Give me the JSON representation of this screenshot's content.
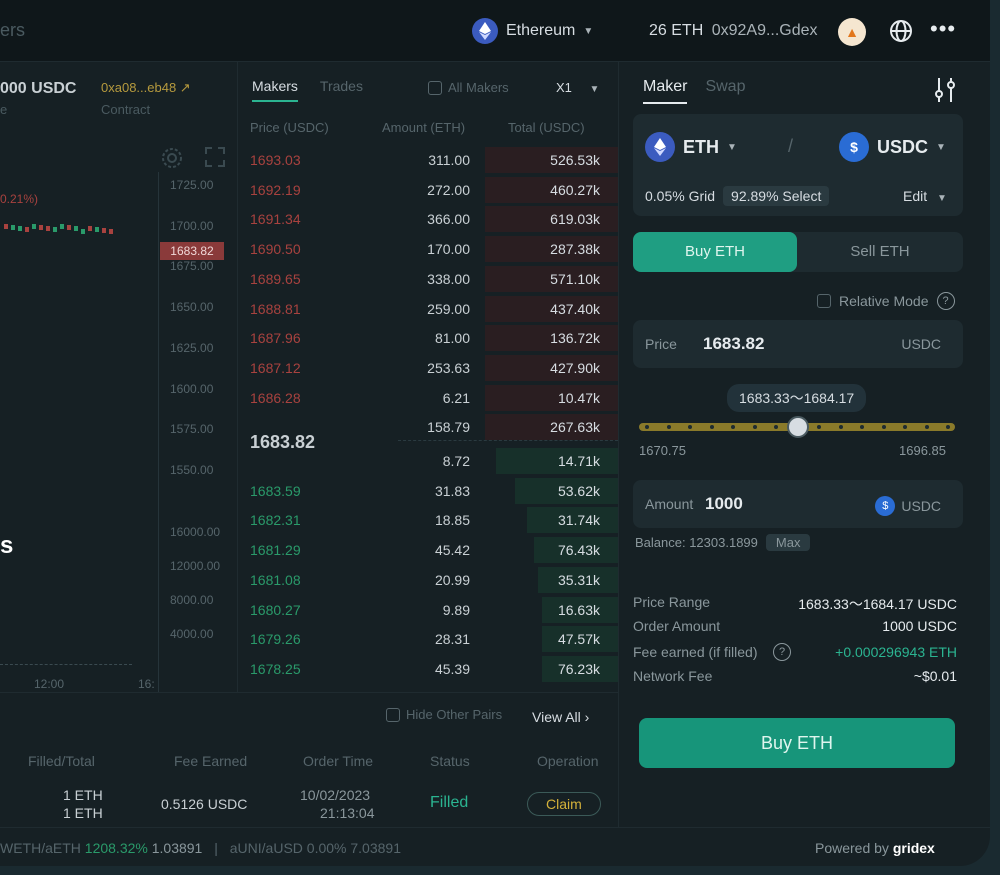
{
  "topbar": {
    "app_title_fragment": "ers",
    "network": "Ethereum",
    "balance": "26 ETH",
    "address": "0x92A9...Gdex"
  },
  "chart_panel": {
    "pair_value": "000 USDC",
    "pair_sub": "e",
    "contract": "0xa08...eb48",
    "contract_label": "Contract",
    "change": "0.21%)",
    "price_axis": [
      "1725.00",
      "1700.00",
      "1675.00",
      "1650.00",
      "1625.00",
      "1600.00",
      "1575.00",
      "1550.00"
    ],
    "highlight_price": "1683.82",
    "volume_axis": [
      "16000.00",
      "12000.00",
      "8000.00",
      "4000.00"
    ],
    "time_labels": [
      "12:00",
      "16:"
    ],
    "side_letter": "s"
  },
  "book": {
    "tabs": [
      "Makers",
      "Trades"
    ],
    "all_makers": "All Makers",
    "multiplier": "X1",
    "headers": [
      "Price (USDC)",
      "Amount (ETH)",
      "Total (USDC)"
    ],
    "asks": [
      {
        "p": "1693.03",
        "a": "311.00",
        "t": "526.53k",
        "depth": 0.35
      },
      {
        "p": "1692.19",
        "a": "272.00",
        "t": "460.27k",
        "depth": 0.35
      },
      {
        "p": "1691.34",
        "a": "366.00",
        "t": "619.03k",
        "depth": 0.35
      },
      {
        "p": "1690.50",
        "a": "170.00",
        "t": "287.38k",
        "depth": 0.35
      },
      {
        "p": "1689.65",
        "a": "338.00",
        "t": "571.10k",
        "depth": 0.35
      },
      {
        "p": "1688.81",
        "a": "259.00",
        "t": "437.40k",
        "depth": 0.35
      },
      {
        "p": "1687.96",
        "a": "81.00",
        "t": "136.72k",
        "depth": 0.35
      },
      {
        "p": "1687.12",
        "a": "253.63",
        "t": "427.90k",
        "depth": 0.35
      },
      {
        "p": "1686.28",
        "a": "6.21",
        "t": "10.47k",
        "depth": 0.35
      },
      {
        "p": "",
        "a": "158.79",
        "t": "267.63k",
        "depth": 0.35
      }
    ],
    "mid_price": "1683.82",
    "bids": [
      {
        "p": "",
        "a": "8.72",
        "t": "14.71k",
        "depth": 0.32
      },
      {
        "p": "1683.59",
        "a": "31.83",
        "t": "53.62k",
        "depth": 0.27
      },
      {
        "p": "1682.31",
        "a": "18.85",
        "t": "31.74k",
        "depth": 0.24
      },
      {
        "p": "1681.29",
        "a": "45.42",
        "t": "76.43k",
        "depth": 0.22
      },
      {
        "p": "1681.08",
        "a": "20.99",
        "t": "35.31k",
        "depth": 0.21
      },
      {
        "p": "1680.27",
        "a": "9.89",
        "t": "16.63k",
        "depth": 0.2
      },
      {
        "p": "1679.26",
        "a": "28.31",
        "t": "47.57k",
        "depth": 0.2
      },
      {
        "p": "1678.25",
        "a": "45.39",
        "t": "76.23k",
        "depth": 0.2
      }
    ]
  },
  "orders": {
    "hide_other_pairs": "Hide Other Pairs",
    "view_all": "View All",
    "headers": [
      "Filled/Total",
      "Fee Earned",
      "Order Time",
      "Status",
      "Operation"
    ],
    "row": {
      "filled": "1 ETH",
      "total": "1 ETH",
      "fee": "0.5126 USDC",
      "date": "10/02/2023",
      "time": "21:13:04",
      "status": "Filled",
      "operation": "Claim"
    }
  },
  "footer": {
    "ticker1_pair": "WETH/aETH",
    "ticker1_change": "1208.32%",
    "ticker1_price": "1.03891",
    "ticker2": "aUNI/aUSD 0.00% 7.03891",
    "powered_by": "Powered by",
    "brand": "gridex"
  },
  "panel": {
    "tabs": [
      "Maker",
      "Swap"
    ],
    "base": "ETH",
    "quote": "USDC",
    "grid_label": "0.05% Grid",
    "select_label": "92.89% Select",
    "edit": "Edit",
    "buy_tab": "Buy ETH",
    "sell_tab": "Sell ETH",
    "relative_mode": "Relative Mode",
    "price_label": "Price",
    "price_value": "1683.82",
    "price_unit": "USDC",
    "range_bubble": "1683.33～1684.17",
    "slider_min": "1670.75",
    "slider_max": "1696.85",
    "slider_position": 0.5,
    "amount_label": "Amount",
    "amount_value": "1000",
    "amount_unit": "USDC",
    "balance": "Balance: 12303.1899",
    "max": "Max",
    "summary": [
      {
        "k": "Price Range",
        "v": "1683.33～1684.17 USDC"
      },
      {
        "k": "Order Amount",
        "v": "1000 USDC"
      },
      {
        "k": "Fee earned (if filled)",
        "v": "+0.000296943 ETH"
      },
      {
        "k": "Network Fee",
        "v": "~$0.01"
      }
    ],
    "submit": "Buy ETH"
  },
  "colors": {
    "accent": "#1f9e82",
    "ask": "#a8423f",
    "bid": "#2a9a6a",
    "slider": "#8a7a2a"
  }
}
